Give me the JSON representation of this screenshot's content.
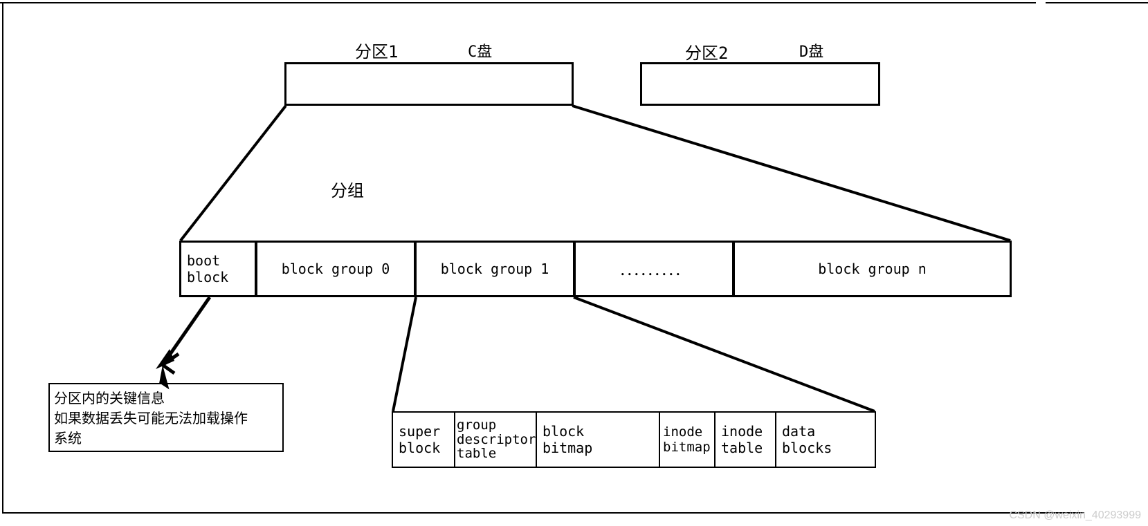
{
  "partition1": {
    "title": "分区1",
    "drive": "C盘"
  },
  "partition2": {
    "title": "分区2",
    "drive": "D盘"
  },
  "group_label": "分组",
  "row": {
    "boot": "boot\nblock",
    "bg0": "block group 0",
    "bg1": "block group 1",
    "dots": "．．．．．．．．．",
    "bgn": "block group n"
  },
  "boot_note": {
    "line1": "分区内的关键信息",
    "line2": "如果数据丢失可能无法加载操作",
    "line3": "系统"
  },
  "detail": {
    "super": "super\nblock",
    "gdt": "group\ndescriptor\ntable",
    "bbitmap": "block\nbitmap",
    "ibitmap": "inode\nbitmap",
    "itable": "inode\ntable",
    "datablocks": "data blocks"
  },
  "watermark": "CSDN @weixin_40293999"
}
